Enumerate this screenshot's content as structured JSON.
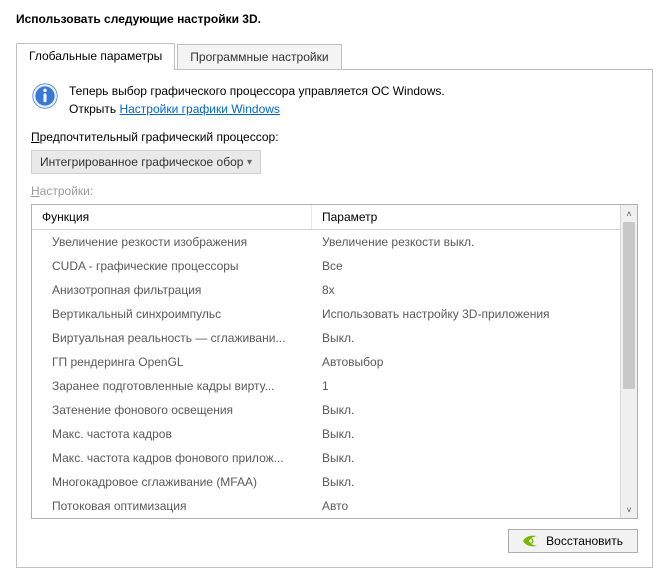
{
  "heading": "Использовать следующие настройки 3D.",
  "tabs": {
    "global": "Глобальные параметры",
    "program": "Программные настройки"
  },
  "info": {
    "line1": "Теперь выбор графического процессора управляется ОС Windows.",
    "open_prefix": "Открыть ",
    "link": "Настройки графики Windows"
  },
  "pref_gpu_label": "редпочтительный графический процессор:",
  "pref_gpu_underline": "П",
  "gpu_select": "Интегрированное графическое обор",
  "settings_label_underline": "Н",
  "settings_label": "астройки:",
  "columns": {
    "func": "Функция",
    "param": "Параметр"
  },
  "rows": [
    {
      "f": "Увеличение резкости изображения",
      "p": "Увеличение резкости выкл."
    },
    {
      "f": "CUDA - графические процессоры",
      "p": "Все"
    },
    {
      "f": "Анизотропная фильтрация",
      "p": "8x"
    },
    {
      "f": "Вертикальный синхроимпульс",
      "p": "Использовать настройку 3D-приложения"
    },
    {
      "f": "Виртуальная реальность — сглаживани...",
      "p": "Выкл."
    },
    {
      "f": "ГП рендеринга OpenGL",
      "p": "Автовыбор"
    },
    {
      "f": "Заранее подготовленные кадры вирту...",
      "p": "1"
    },
    {
      "f": "Затенение фонового освещения",
      "p": "Выкл."
    },
    {
      "f": "Макс. частота кадров",
      "p": "Выкл."
    },
    {
      "f": "Макс. частота кадров фонового прилож...",
      "p": "Выкл."
    },
    {
      "f": "Многокадровое сглаживание (MFAA)",
      "p": "Выкл."
    },
    {
      "f": "Потоковая оптимизация",
      "p": "Авто"
    }
  ],
  "restore": "Восстановить"
}
